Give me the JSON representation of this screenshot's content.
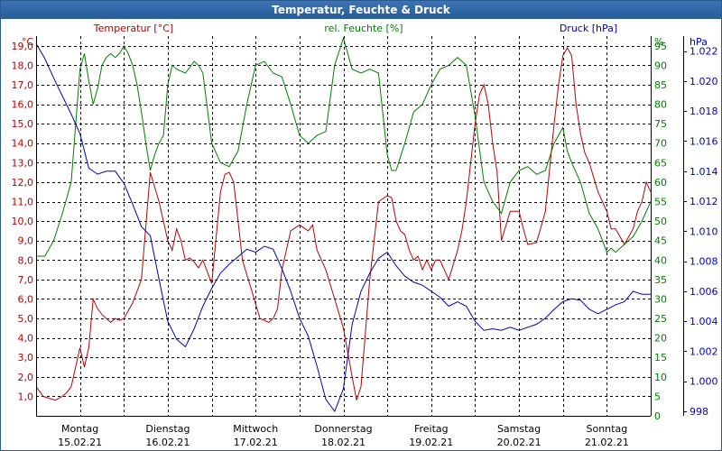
{
  "window": {
    "title": "Temperatur, Feuchte & Druck"
  },
  "colors": {
    "temperature": "#c00000",
    "humidity": "#008000",
    "pressure": "#0000c0",
    "grid": "#000000",
    "axis": "#000000"
  },
  "chart_data": {
    "type": "line",
    "title": "Temperatur, Feuchte & Druck",
    "grid": true,
    "x_days": [
      {
        "day": "Montag",
        "date": "15.02.21"
      },
      {
        "day": "Dienstag",
        "date": "16.02.21"
      },
      {
        "day": "Mittwoch",
        "date": "17.02.21"
      },
      {
        "day": "Donnerstag",
        "date": "18.02.21"
      },
      {
        "day": "Freitag",
        "date": "19.02.21"
      },
      {
        "day": "Samstag",
        "date": "20.02.21"
      },
      {
        "day": "Sonntag",
        "date": "21.02.21"
      }
    ],
    "xlim_days": [
      0,
      7
    ],
    "axes": {
      "temperature": {
        "label": "Temperatur [°C]",
        "unit": "°C",
        "ylim": [
          0,
          19.5
        ],
        "ticks": [
          "1,0",
          "2,0",
          "3,0",
          "4,0",
          "5,0",
          "6,0",
          "7,0",
          "8,0",
          "9,0",
          "10,0",
          "11,0",
          "12,0",
          "13,0",
          "14,0",
          "15,0",
          "16,0",
          "17,0",
          "18,0",
          "19,0"
        ]
      },
      "humidity": {
        "label": "rel. Feuchte [%]",
        "unit": "%",
        "ylim": [
          0,
          97.5
        ],
        "ticks": [
          "0",
          "5",
          "10",
          "15",
          "20",
          "25",
          "30",
          "35",
          "40",
          "45",
          "50",
          "55",
          "60",
          "65",
          "70",
          "75",
          "80",
          "85",
          "90",
          "95"
        ]
      },
      "pressure": {
        "label": "Druck [hPa]",
        "unit": "hPa",
        "ylim": [
          997.7,
          1023.0
        ],
        "ticks": [
          "998",
          "1.000",
          "1.002",
          "1.004",
          "1.006",
          "1.008",
          "1.010",
          "1.012",
          "1.014",
          "1.016",
          "1.018",
          "1.020",
          "1.022"
        ]
      }
    },
    "series": [
      {
        "name": "Temperatur [°C]",
        "axis": "temperature",
        "x": [
          0,
          0.08,
          0.15,
          0.22,
          0.3,
          0.35,
          0.4,
          0.45,
          0.5,
          0.55,
          0.6,
          0.65,
          0.7,
          0.75,
          0.8,
          0.85,
          0.9,
          0.95,
          1.0,
          1.1,
          1.2,
          1.3,
          1.4,
          1.5,
          1.55,
          1.6,
          1.65,
          1.7,
          1.75,
          1.8,
          1.85,
          1.9,
          2.0,
          2.1,
          2.15,
          2.2,
          2.25,
          2.3,
          2.35,
          2.45,
          2.55,
          2.65,
          2.7,
          2.75,
          2.8,
          2.9,
          3.0,
          3.1,
          3.15,
          3.2,
          3.25,
          3.3,
          3.4,
          3.5,
          3.6,
          3.65,
          3.7,
          3.8,
          3.9,
          4.0,
          4.05,
          4.1,
          4.15,
          4.2,
          4.25,
          4.3,
          4.35,
          4.4,
          4.45,
          4.5,
          4.55,
          4.6,
          4.7,
          4.8,
          4.85,
          4.9,
          5.0,
          5.05,
          5.1,
          5.15,
          5.2,
          5.25,
          5.3,
          5.4,
          5.5,
          5.55,
          5.6,
          5.7,
          5.8,
          5.9,
          5.95,
          6.0,
          6.05,
          6.1,
          6.15,
          6.2,
          6.25,
          6.3,
          6.4,
          6.5,
          6.55,
          6.6,
          6.7,
          6.8,
          6.85,
          6.9,
          6.95,
          7.0
        ],
        "values": [
          1.5,
          1.0,
          0.9,
          0.8,
          1.0,
          1.2,
          1.5,
          2.5,
          3.5,
          2.5,
          3.5,
          6.0,
          5.5,
          5.2,
          5.0,
          4.8,
          5.0,
          4.9,
          5.0,
          5.8,
          7.0,
          12.5,
          11.0,
          9.0,
          8.5,
          9.6,
          9.0,
          8.0,
          8.1,
          7.9,
          7.6,
          8.0,
          6.8,
          11.5,
          12.4,
          12.5,
          12.0,
          10.0,
          8.0,
          6.5,
          5.0,
          4.8,
          5.0,
          5.5,
          7.5,
          9.5,
          9.8,
          9.5,
          9.8,
          8.5,
          8.0,
          7.5,
          6.0,
          4.5,
          2.0,
          0.8,
          1.5,
          7.0,
          11.0,
          11.3,
          11.2,
          10.0,
          9.5,
          9.3,
          8.5,
          8.0,
          8.2,
          7.5,
          8.0,
          7.5,
          8.0,
          8.0,
          7.0,
          8.5,
          9.5,
          11.0,
          15.0,
          16.5,
          17.0,
          16.0,
          14.0,
          12.5,
          9.0,
          10.5,
          10.5,
          9.6,
          8.8,
          8.9,
          10.5,
          15.0,
          17.0,
          18.5,
          18.9,
          18.5,
          16.0,
          14.5,
          13.5,
          13.0,
          11.5,
          10.5,
          9.6,
          9.6,
          8.8,
          9.6,
          10.5,
          11.0,
          12.0,
          11.5
        ],
        "color": "#c00000"
      },
      {
        "name": "rel. Feuchte [%]",
        "axis": "humidity",
        "x": [
          0,
          0.1,
          0.2,
          0.3,
          0.4,
          0.5,
          0.55,
          0.6,
          0.65,
          0.7,
          0.75,
          0.8,
          0.85,
          0.9,
          0.95,
          1.0,
          1.05,
          1.1,
          1.15,
          1.2,
          1.25,
          1.3,
          1.35,
          1.4,
          1.45,
          1.5,
          1.55,
          1.6,
          1.7,
          1.8,
          1.85,
          1.9,
          2.0,
          2.1,
          2.2,
          2.3,
          2.4,
          2.5,
          2.6,
          2.7,
          2.8,
          2.9,
          3.0,
          3.1,
          3.2,
          3.3,
          3.4,
          3.5,
          3.6,
          3.7,
          3.8,
          3.9,
          4.0,
          4.05,
          4.1,
          4.2,
          4.3,
          4.4,
          4.5,
          4.6,
          4.7,
          4.8,
          4.9,
          5.0,
          5.1,
          5.2,
          5.3,
          5.4,
          5.5,
          5.6,
          5.7,
          5.8,
          5.9,
          6.0,
          6.05,
          6.1,
          6.2,
          6.3,
          6.35,
          6.4,
          6.45,
          6.5,
          6.55,
          6.6,
          6.65,
          6.7,
          6.8,
          6.9,
          7.0
        ],
        "values": [
          41,
          41,
          45,
          52,
          60,
          89,
          93,
          86,
          80,
          84,
          90,
          92,
          93,
          92,
          93,
          95,
          93,
          90,
          85,
          78,
          70,
          63,
          67,
          70,
          72,
          85,
          90,
          89,
          88,
          91,
          90,
          88,
          70,
          65,
          64,
          68,
          80,
          90,
          91,
          88,
          87,
          80,
          72,
          70,
          72,
          73,
          90,
          97,
          89,
          88,
          89,
          88,
          67,
          63,
          63,
          70,
          78,
          80,
          85,
          89,
          90,
          92,
          90,
          77,
          60,
          55,
          52,
          60,
          63,
          64,
          62,
          63,
          70,
          74,
          68,
          65,
          60,
          52,
          50,
          48,
          45,
          42,
          43,
          42,
          43,
          44,
          46,
          50,
          55
        ],
        "color": "#008000"
      },
      {
        "name": "Druck [hPa]",
        "axis": "pressure",
        "x": [
          0,
          0.1,
          0.2,
          0.3,
          0.4,
          0.5,
          0.6,
          0.7,
          0.8,
          0.9,
          1.0,
          1.1,
          1.2,
          1.3,
          1.4,
          1.5,
          1.6,
          1.7,
          1.8,
          1.9,
          2.0,
          2.1,
          2.2,
          2.3,
          2.4,
          2.5,
          2.6,
          2.7,
          2.8,
          2.9,
          3.0,
          3.1,
          3.2,
          3.3,
          3.4,
          3.5,
          3.6,
          3.7,
          3.8,
          3.9,
          4.0,
          4.1,
          4.2,
          4.3,
          4.4,
          4.5,
          4.6,
          4.7,
          4.8,
          4.9,
          5.0,
          5.1,
          5.2,
          5.3,
          5.4,
          5.5,
          5.6,
          5.7,
          5.8,
          5.9,
          6.0,
          6.1,
          6.2,
          6.3,
          6.4,
          6.5,
          6.6,
          6.7,
          6.8,
          6.9,
          7.0
        ],
        "values": [
          1022.5,
          1021.5,
          1020.2,
          1019.0,
          1017.8,
          1016.5,
          1014.2,
          1013.8,
          1014.0,
          1014.0,
          1013.2,
          1011.8,
          1010.3,
          1009.7,
          1006.8,
          1004.0,
          1002.8,
          1002.3,
          1003.5,
          1005.0,
          1006.2,
          1007.2,
          1007.8,
          1008.3,
          1008.8,
          1008.6,
          1009.0,
          1008.8,
          1007.5,
          1006.0,
          1004.2,
          1003.0,
          1001.0,
          998.8,
          998.0,
          999.5,
          1003.8,
          1006.0,
          1007.2,
          1008.2,
          1008.6,
          1007.7,
          1007.0,
          1006.6,
          1006.4,
          1006.0,
          1005.6,
          1005.0,
          1005.3,
          1005.0,
          1004.0,
          1003.4,
          1003.5,
          1003.4,
          1003.6,
          1003.4,
          1003.6,
          1003.8,
          1004.2,
          1004.8,
          1005.3,
          1005.5,
          1005.4,
          1004.8,
          1004.5,
          1004.8,
          1005.1,
          1005.3,
          1006.0,
          1005.8,
          1005.8
        ],
        "color": "#0000c0"
      }
    ]
  }
}
